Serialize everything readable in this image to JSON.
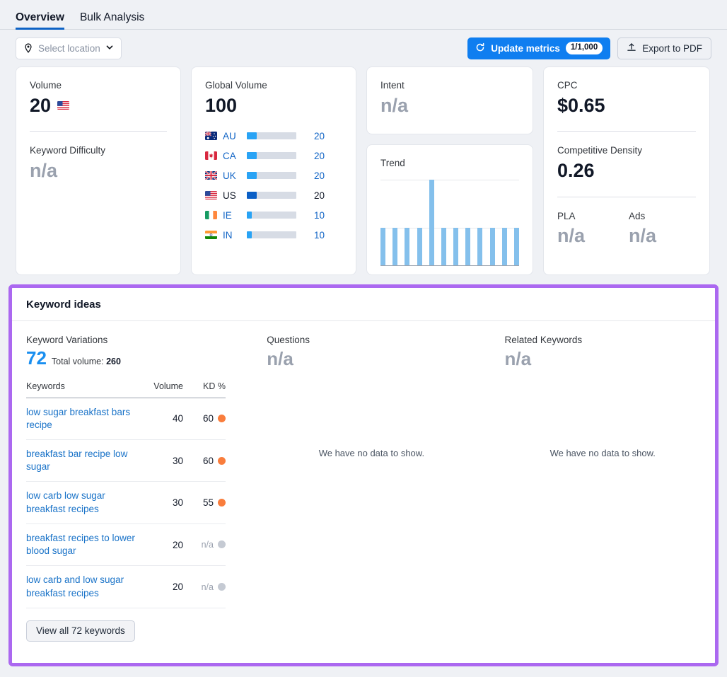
{
  "tabs": [
    {
      "label": "Overview",
      "active": true
    },
    {
      "label": "Bulk Analysis",
      "active": false
    }
  ],
  "toolbar": {
    "location_placeholder": "Select location",
    "update_label": "Update metrics",
    "update_badge": "1/1,000",
    "export_label": "Export to PDF"
  },
  "cards": {
    "volume": {
      "label": "Volume",
      "value": "20",
      "flag": "us-flag-icon"
    },
    "keyword_difficulty": {
      "label": "Keyword Difficulty",
      "value": "n/a"
    },
    "global_volume": {
      "label": "Global Volume",
      "value": "100",
      "rows": [
        {
          "code": "AU",
          "flag": "au-flag-icon",
          "value": "20",
          "pct": 20,
          "selected": false
        },
        {
          "code": "CA",
          "flag": "ca-flag-icon",
          "value": "20",
          "pct": 20,
          "selected": false
        },
        {
          "code": "UK",
          "flag": "uk-flag-icon",
          "value": "20",
          "pct": 20,
          "selected": false
        },
        {
          "code": "US",
          "flag": "us-flag-icon",
          "value": "20",
          "pct": 20,
          "selected": true
        },
        {
          "code": "IE",
          "flag": "ie-flag-icon",
          "value": "10",
          "pct": 10,
          "selected": false
        },
        {
          "code": "IN",
          "flag": "in-flag-icon",
          "value": "10",
          "pct": 10,
          "selected": false
        }
      ]
    },
    "intent": {
      "label": "Intent",
      "value": "n/a"
    },
    "trend": {
      "label": "Trend"
    },
    "cpc": {
      "label": "CPC",
      "value": "$0.65"
    },
    "competitive_density": {
      "label": "Competitive Density",
      "value": "0.26"
    },
    "pla": {
      "label": "PLA",
      "value": "n/a"
    },
    "ads": {
      "label": "Ads",
      "value": "n/a"
    }
  },
  "chart_data": {
    "type": "bar",
    "title": "Trend",
    "categories": [
      "1",
      "2",
      "3",
      "4",
      "5",
      "6",
      "7",
      "8",
      "9",
      "10",
      "11",
      "12"
    ],
    "values": [
      34,
      34,
      34,
      34,
      100,
      34,
      34,
      34,
      34,
      34,
      34,
      34
    ],
    "xlabel": "",
    "ylabel": "",
    "ylim": [
      0,
      100
    ],
    "grid": true,
    "legend": "none",
    "bar_color": "#84c0ec"
  },
  "keyword_ideas": {
    "title": "Keyword ideas",
    "variations": {
      "title": "Keyword Variations",
      "count": "72",
      "total_volume_label": "Total volume:",
      "total_volume": "260",
      "columns": [
        "Keywords",
        "Volume",
        "KD %"
      ],
      "rows": [
        {
          "keyword": "low sugar breakfast bars recipe",
          "volume": "40",
          "kd": "60",
          "kd_color": "#f97d3c"
        },
        {
          "keyword": "breakfast bar recipe low sugar",
          "volume": "30",
          "kd": "60",
          "kd_color": "#f97d3c"
        },
        {
          "keyword": "low carb low sugar breakfast recipes",
          "volume": "30",
          "kd": "55",
          "kd_color": "#f97d3c"
        },
        {
          "keyword": "breakfast recipes to lower blood sugar",
          "volume": "20",
          "kd": "n/a",
          "kd_color": "#c5cad3"
        },
        {
          "keyword": "low carb and low sugar breakfast recipes",
          "volume": "20",
          "kd": "n/a",
          "kd_color": "#c5cad3"
        }
      ],
      "view_all_label": "View all 72 keywords"
    },
    "questions": {
      "title": "Questions",
      "value": "n/a",
      "empty": "We have no data to show."
    },
    "related": {
      "title": "Related Keywords",
      "value": "n/a",
      "empty": "We have no data to show."
    }
  },
  "colors": {
    "accent_blue": "#0f7ef0",
    "tab_underline": "#0f63c5",
    "panel_highlight": "#ab68f0",
    "kd_orange": "#f97d3c",
    "kd_grey": "#c5cad3",
    "bar_blue": "#29a3f5",
    "bar_blue_selected": "#0a5fc6",
    "trend_bar": "#84c0ec",
    "page_bg": "#eff1f5"
  }
}
